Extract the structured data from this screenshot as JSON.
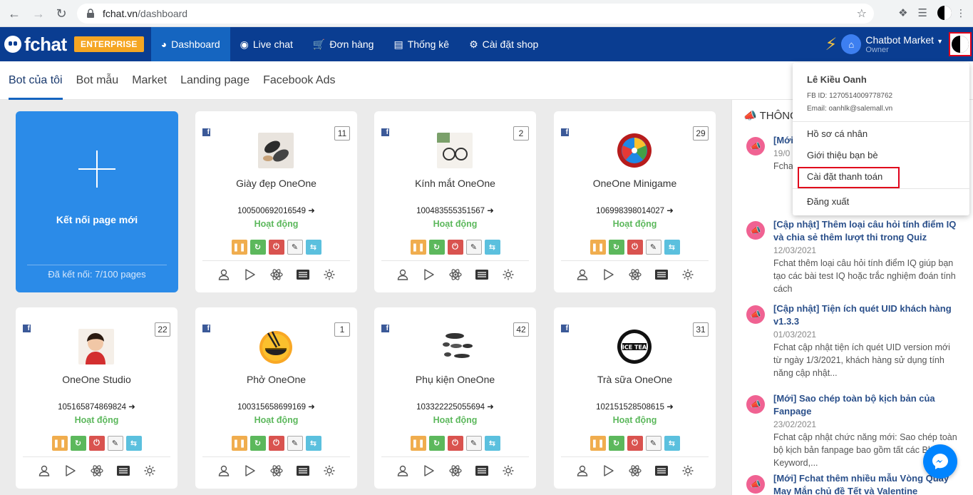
{
  "browser": {
    "url_host": "fchat.vn",
    "url_path": "/dashboard"
  },
  "header": {
    "logo_text": "fchat",
    "badge": "ENTERPRISE",
    "nav": [
      {
        "label": "Dashboard",
        "icon": "dashboard-icon",
        "active": true
      },
      {
        "label": "Live chat",
        "icon": "chat-bubble-icon",
        "active": false
      },
      {
        "label": "Đơn hàng",
        "icon": "cart-icon",
        "active": false
      },
      {
        "label": "Thống kê",
        "icon": "bar-chart-icon",
        "active": false
      },
      {
        "label": "Cài đặt shop",
        "icon": "gear-icon",
        "active": false
      }
    ],
    "shop_name": "Chatbot Market",
    "shop_role": "Owner"
  },
  "subtabs": [
    {
      "label": "Bot của tôi",
      "active": true
    },
    {
      "label": "Bot mẫu",
      "active": false
    },
    {
      "label": "Market",
      "active": false
    },
    {
      "label": "Landing page",
      "active": false
    },
    {
      "label": "Facebook Ads",
      "active": false
    }
  ],
  "add_card": {
    "title": "Kết nối page mới",
    "connected": "Đã kết nối: 7/100 pages"
  },
  "bots": [
    {
      "name": "Giày đẹp OneOne",
      "id": "100500692016549",
      "count": "11",
      "status": "Hoạt động",
      "avatar": "shoes"
    },
    {
      "name": "Kính mắt OneOne",
      "id": "100483555351567",
      "count": "2",
      "status": "Hoạt động",
      "avatar": "glasses"
    },
    {
      "name": "OneOne Minigame",
      "id": "106998398014027",
      "count": "29",
      "status": "Hoạt động",
      "avatar": "wheel"
    },
    {
      "name": "OneOne Studio",
      "id": "105165874869824",
      "count": "22",
      "status": "Hoạt động",
      "avatar": "child"
    },
    {
      "name": "Phở OneOne",
      "id": "100315658699169",
      "count": "1",
      "status": "Hoạt động",
      "avatar": "pho"
    },
    {
      "name": "Phụ kiện OneOne",
      "id": "103322225055694",
      "count": "42",
      "status": "Hoạt động",
      "avatar": "accessories"
    },
    {
      "name": "Trà sữa OneOne",
      "id": "102151528508615",
      "count": "31",
      "status": "Hoạt động",
      "avatar": "icetea"
    }
  ],
  "news": {
    "title": "THÔNG",
    "items": [
      {
        "head": "[Mới] ... Zalo",
        "date": "19/0",
        "text": "Fchat ... Zalo ... bản t"
      },
      {
        "head": "[Cập nhật] Thêm loại câu hỏi tính điểm IQ và chia sẻ thêm lượt thi trong Quiz",
        "date": "12/03/2021",
        "text": "Fchat thêm loại câu hỏi tính điểm IQ giúp bạn tạo các bài test IQ hoặc trắc nghiệm đoán tính cách"
      },
      {
        "head": "[Cập nhật] Tiện ích quét UID khách hàng v1.3.3",
        "date": "01/03/2021",
        "text": "Fchat cập nhật tiện ích quét UID version mới từ ngày 1/3/2021, khách hàng sử dụng tính năng cập nhật..."
      },
      {
        "head": "[Mới] Sao chép toàn bộ kịch bản của Fanpage",
        "date": "23/02/2021",
        "text": "Fchat cập nhật chức năng mới: Sao chép toàn bộ kịch bản fanpage bao gồm tất các Block, Keyword,..."
      },
      {
        "head": "[Mới] Fchat thêm nhiều mẫu Vòng Quay May Mắn chủ đề Tết và Valentine",
        "date": "",
        "text": ""
      }
    ]
  },
  "dropdown": {
    "name": "Lê Kiều Oanh",
    "fb_id": "FB ID: 1270514009778762",
    "email": "Email: oanhlk@salemall.vn",
    "items": [
      "Hồ sơ cá nhân",
      "Giới thiệu bạn bè",
      "Cài đặt thanh toán",
      "Đăng xuất"
    ]
  }
}
